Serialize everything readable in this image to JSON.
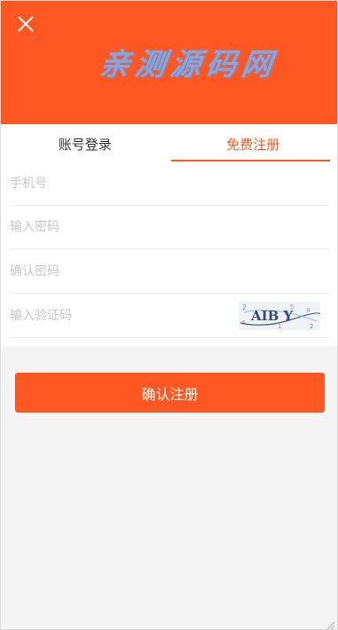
{
  "header": {
    "logo_text": "亲测源码网",
    "close_icon": "close-icon",
    "background_color": "#ff5722"
  },
  "tabs": [
    {
      "label": "账号登录",
      "active": false
    },
    {
      "label": "免费注册",
      "active": true
    }
  ],
  "form": {
    "phone_placeholder": "手机号",
    "password_placeholder": "输入密码",
    "confirm_password_placeholder": "确认密码",
    "captcha_placeholder": "输入验证码",
    "captcha_text": "AIB Y"
  },
  "submit_label": "确认注册",
  "accent_color": "#ff5722"
}
